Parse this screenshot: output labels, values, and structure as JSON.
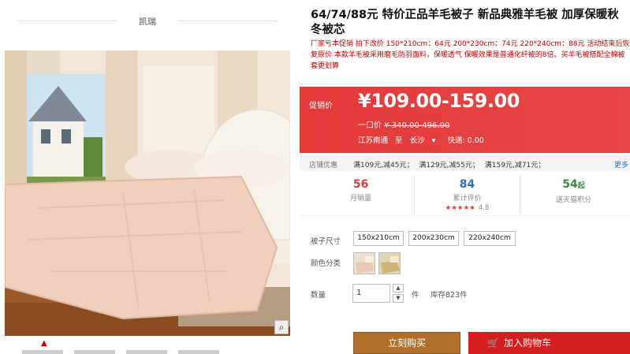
{
  "brand": {
    "name": "凯瑞"
  },
  "gallery": {
    "zoom_icon": "magnifier-icon",
    "thumb_arrow": "▲"
  },
  "product": {
    "title": "64/74/88元 特价正品羊毛被子 新品典雅羊毛被 加厚保暖秋冬被芯",
    "subtitle": "厂家亏本促销 拍下改价 150*210cm：64元 200*230cm：74元 220*240cm：88元 活动结束后恢复原价 本款羊毛被采用磨毛防羽面料，保暖透气 保暖效果是普通化纤被的8倍。买羊毛被搭配全棉被套更划算"
  },
  "price_panel": {
    "promo_label": "促销价",
    "price": "¥109.00-159.00",
    "orig_label": "一口价",
    "orig_price": "¥ 340.00-496.00",
    "ship_from": "江苏南通",
    "ship_to_label": "至",
    "ship_to": "长沙",
    "ship_dropdown": "▾",
    "express": "快递: 0.00"
  },
  "coupons": {
    "label": "店铺优惠",
    "items": [
      "满109元,减45元；",
      "满129元,减55元；",
      "满159元,减71元；"
    ],
    "more": "更多"
  },
  "stats": {
    "monthly_sales": "56",
    "monthly_sales_label": "月销量",
    "reviews": "84",
    "reviews_label": "累计评价",
    "rating_stars": "★★★★★",
    "rating_score": "4.8",
    "points": "54",
    "points_unit": "起",
    "points_label": "送天猫积分"
  },
  "options": {
    "size_label": "被子尺寸",
    "sizes": [
      "150x210cm",
      "200x230cm",
      "220x240cm"
    ],
    "color_label": "颜色分类",
    "qty_label": "数量",
    "qty_value": "1",
    "qty_up": "▲",
    "qty_down": "▼",
    "qty_unit": "件",
    "stock": "库存823件"
  },
  "actions": {
    "buy_now": "立刻购买",
    "add_to_cart": "加入购物车",
    "cart_icon": "🛒"
  },
  "colors": {
    "accent_red": "#e4393c",
    "buy_brown": "#b0702c"
  }
}
